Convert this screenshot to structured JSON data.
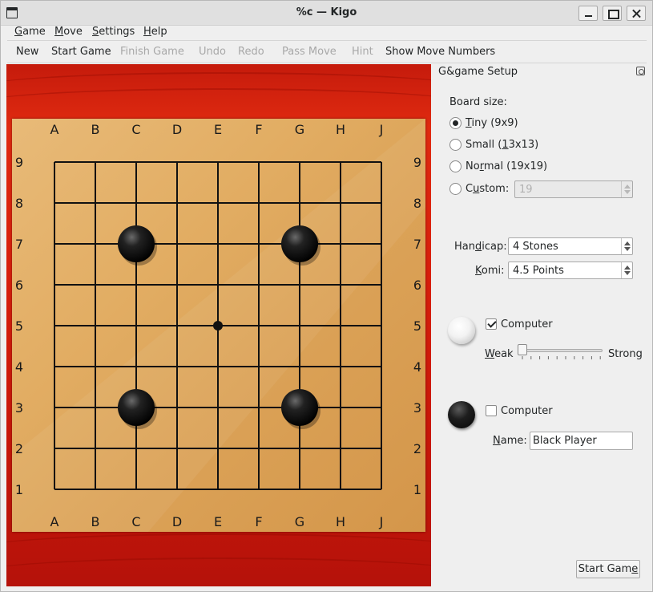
{
  "window": {
    "title": "%c — Kigo"
  },
  "menu": {
    "game": {
      "mnemonic": "G",
      "rest": "ame"
    },
    "move": {
      "mnemonic": "M",
      "rest": "ove"
    },
    "settings": {
      "mnemonic": "S",
      "rest": "ettings"
    },
    "help": {
      "mnemonic": "H",
      "rest": "elp"
    }
  },
  "toolbar": {
    "new": "New",
    "start_game": "Start Game",
    "finish_game": "Finish Game",
    "undo": "Undo",
    "redo": "Redo",
    "pass_move": "Pass Move",
    "hint": "Hint",
    "show_move_numbers": "Show Move Numbers"
  },
  "board": {
    "columns": [
      "A",
      "B",
      "C",
      "D",
      "E",
      "F",
      "G",
      "H",
      "J"
    ],
    "rows": [
      "9",
      "8",
      "7",
      "6",
      "5",
      "4",
      "3",
      "2",
      "1"
    ],
    "star_point": {
      "col": "E",
      "row": "5"
    },
    "stones": [
      {
        "col": "C",
        "row": "7",
        "color": "black"
      },
      {
        "col": "G",
        "row": "7",
        "color": "black"
      },
      {
        "col": "C",
        "row": "3",
        "color": "black"
      },
      {
        "col": "G",
        "row": "3",
        "color": "black"
      }
    ]
  },
  "setup": {
    "title": "G&game Setup",
    "board_size_label": "Board size:",
    "sizes": [
      {
        "pre": "",
        "u": "T",
        "post": "iny (9x9)",
        "checked": true
      },
      {
        "pre": "Small (",
        "u": "1",
        "post": "3x13)",
        "checked": false
      },
      {
        "pre": "No",
        "u": "r",
        "post": "mal (19x19)",
        "checked": false
      },
      {
        "pre": "C",
        "u": "u",
        "post": "stom:",
        "checked": false
      }
    ],
    "custom_value": "19",
    "handicap": {
      "pre": "Han",
      "u": "d",
      "post": "icap:",
      "value": "4 Stones"
    },
    "komi": {
      "pre": "",
      "u": "K",
      "post": "omi:",
      "value": "4.5 Points"
    },
    "white_player": {
      "computer_label": "Computer",
      "computer_checked": true,
      "weak_pre": "",
      "weak_u": "W",
      "weak_post": "eak",
      "strong": "Strong",
      "strength": 0
    },
    "black_player": {
      "computer_label": "Computer",
      "computer_checked": false,
      "name_pre": "",
      "name_u": "N",
      "name_post": "ame:",
      "name_value": "Black Player"
    },
    "start_button": {
      "pre": "Start Gam",
      "u": "e",
      "post": ""
    }
  }
}
